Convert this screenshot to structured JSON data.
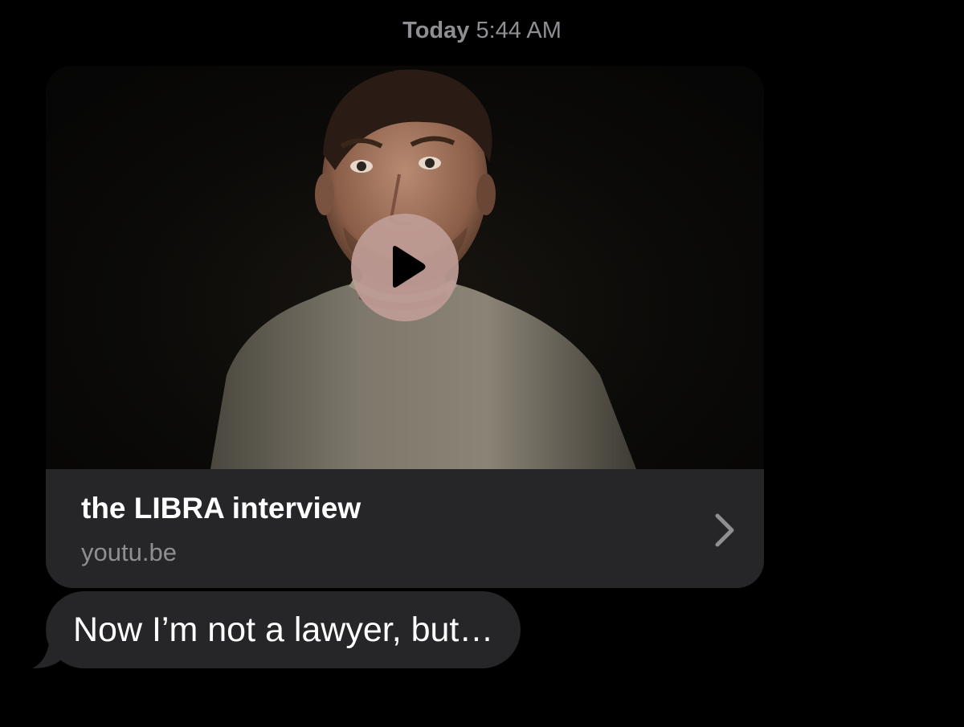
{
  "timestamp": {
    "day": "Today",
    "time": "5:44 AM"
  },
  "link_preview": {
    "title": "the LIBRA interview",
    "domain": "youtu.be",
    "thumbnail": "video-thumbnail-man-grey-sweater",
    "play_icon": "play-icon",
    "chevron_icon": "chevron-right-icon"
  },
  "messages": [
    {
      "text": "Now I’m not a lawyer, but…"
    }
  ],
  "colors": {
    "background": "#000000",
    "bubble": "#262628",
    "secondary_text": "#8e8e93",
    "play_button": "#be9c96"
  }
}
